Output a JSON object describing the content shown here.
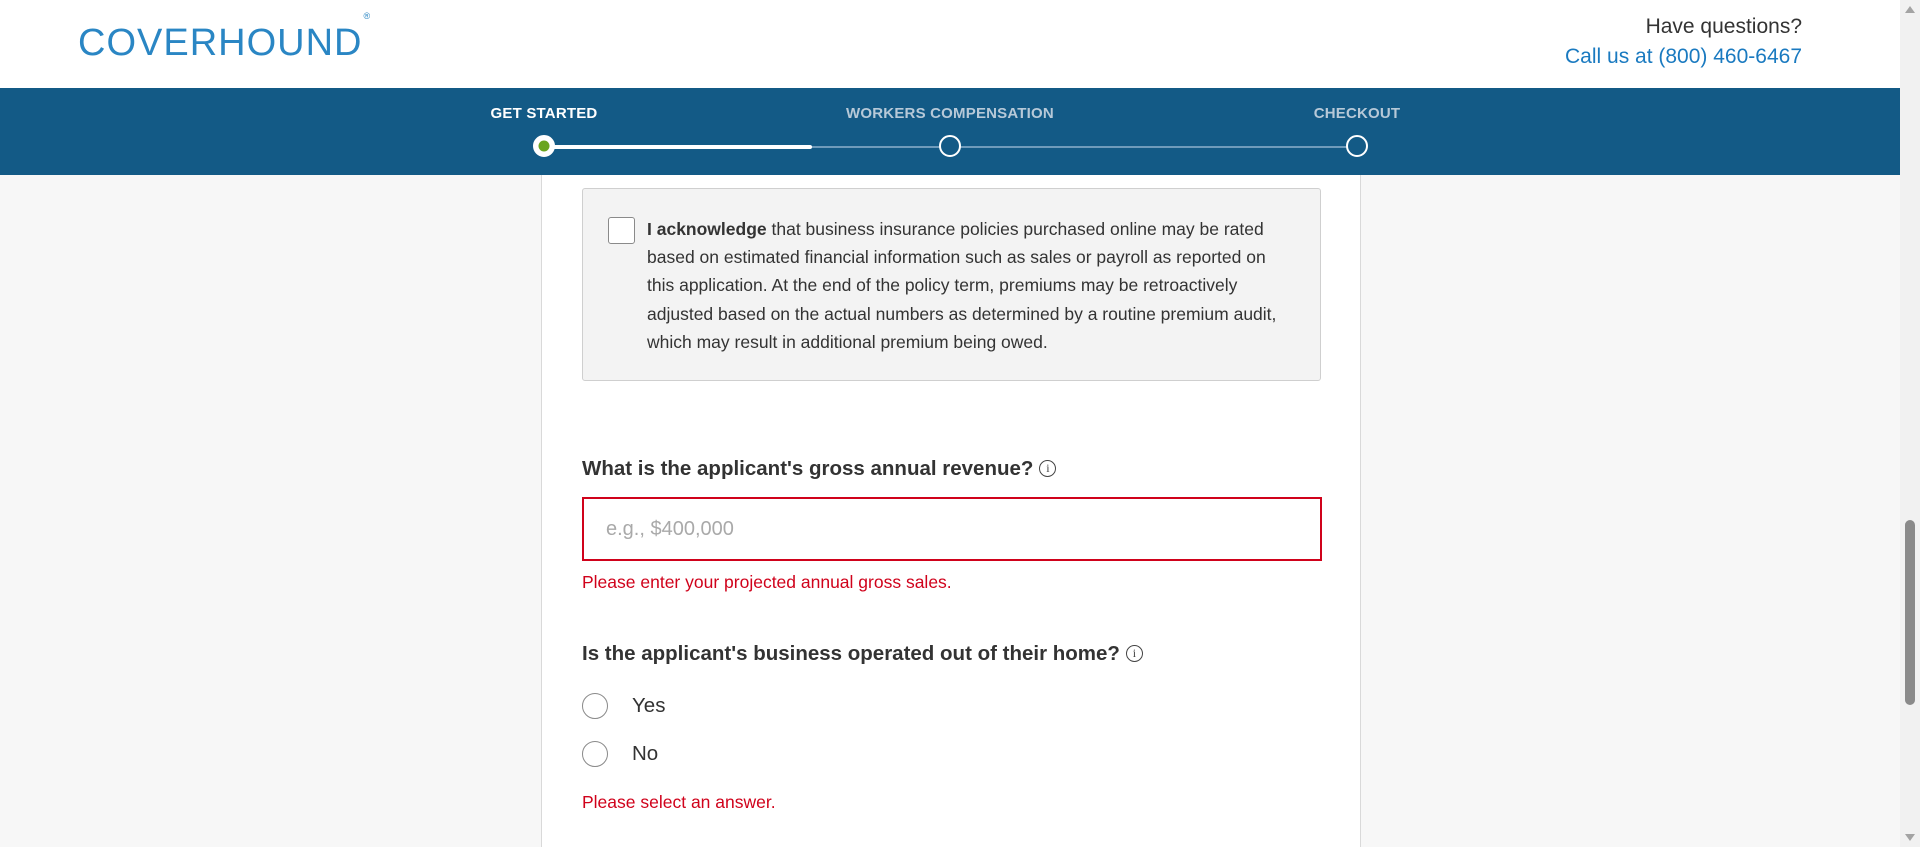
{
  "header": {
    "logo": "COVERHOUND",
    "logo_mark": "®",
    "help_question": "Have questions?",
    "help_call": "Call us at (800) 460-6467"
  },
  "progress": {
    "steps": [
      {
        "label": "GET STARTED",
        "state": "active"
      },
      {
        "label": "WORKERS COMPENSATION",
        "state": "pending"
      },
      {
        "label": "CHECKOUT",
        "state": "pending"
      }
    ],
    "completion": 0.33
  },
  "acknowledge": {
    "checked": false,
    "bold_lead": "I acknowledge",
    "text": " that business insurance policies purchased online may be rated based on estimated financial information such as sales or payroll as reported on this application. At the end of the policy term, premiums may be retroactively adjusted based on the actual numbers as determined by a routine premium audit, which may result in additional premium being owed."
  },
  "revenue": {
    "question": "What is the applicant's gross annual revenue?",
    "info_icon": "info-icon",
    "value": "",
    "placeholder": "e.g., $400,000",
    "error": "Please enter your projected annual gross sales."
  },
  "home_business": {
    "question": "Is the applicant's business operated out of their home?",
    "info_icon": "info-icon",
    "options": [
      {
        "label": "Yes",
        "selected": false
      },
      {
        "label": "No",
        "selected": false
      }
    ],
    "error": "Please select an answer."
  },
  "colors": {
    "brand_blue": "#2a86c4",
    "nav_bg": "#135a86",
    "error_red": "#d0021b",
    "active_dot": "#6aa51f"
  }
}
